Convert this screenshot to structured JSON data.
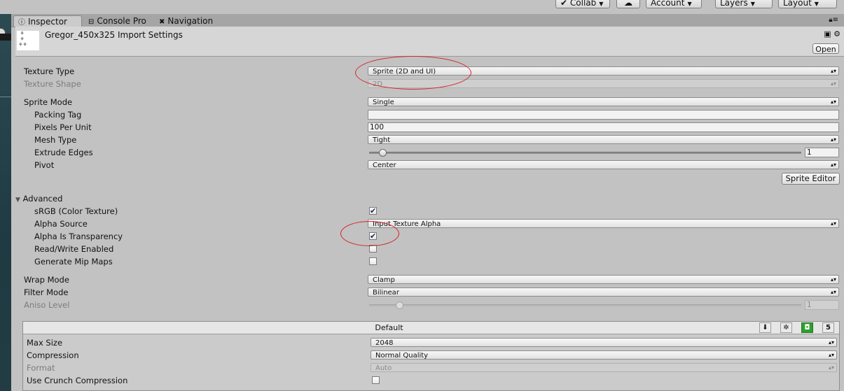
{
  "toolbar": {
    "collab": "Collab",
    "account": "Account",
    "layers": "Layers",
    "layout": "Layout"
  },
  "tabs": [
    {
      "label": "Inspector",
      "icon": "info-icon"
    },
    {
      "label": "Console Pro",
      "icon": "console-icon"
    },
    {
      "label": "Navigation",
      "icon": "navigation-icon"
    }
  ],
  "header": {
    "title": "Gregor_450x325 Import Settings",
    "open_label": "Open"
  },
  "fields": {
    "texture_type": {
      "label": "Texture Type",
      "value": "Sprite (2D and UI)"
    },
    "texture_shape": {
      "label": "Texture Shape",
      "value": "2D"
    },
    "sprite_mode": {
      "label": "Sprite Mode",
      "value": "Single"
    },
    "packing_tag": {
      "label": "Packing Tag",
      "value": ""
    },
    "pixels_per_unit": {
      "label": "Pixels Per Unit",
      "value": "100"
    },
    "mesh_type": {
      "label": "Mesh Type",
      "value": "Tight"
    },
    "extrude_edges": {
      "label": "Extrude Edges",
      "value": "1",
      "slider_fraction": 0.03
    },
    "pivot": {
      "label": "Pivot",
      "value": "Center"
    },
    "sprite_editor_label": "Sprite Editor"
  },
  "advanced": {
    "label": "Advanced",
    "srgb": {
      "label": "sRGB (Color Texture)",
      "checked": true
    },
    "alpha_source": {
      "label": "Alpha Source",
      "value": "Input Texture Alpha"
    },
    "alpha_is_transparency": {
      "label": "Alpha Is Transparency",
      "checked": true
    },
    "read_write": {
      "label": "Read/Write Enabled",
      "checked": false
    },
    "generate_mips": {
      "label": "Generate Mip Maps",
      "checked": false
    }
  },
  "sampling": {
    "wrap_mode": {
      "label": "Wrap Mode",
      "value": "Clamp"
    },
    "filter_mode": {
      "label": "Filter Mode",
      "value": "Bilinear"
    },
    "aniso_level": {
      "label": "Aniso Level",
      "value": "1",
      "slider_fraction": 0.07
    }
  },
  "platform": {
    "tab_label": "Default",
    "max_size": {
      "label": "Max Size",
      "value": "2048"
    },
    "compression": {
      "label": "Compression",
      "value": "Normal Quality"
    },
    "format": {
      "label": "Format",
      "value": "Auto"
    },
    "crunch": {
      "label": "Use Crunch Compression",
      "checked": false
    },
    "icons": [
      "download-icon",
      "android-icon",
      "xbox-icon",
      "html5-icon"
    ]
  },
  "annotation_color": "#d3232b"
}
